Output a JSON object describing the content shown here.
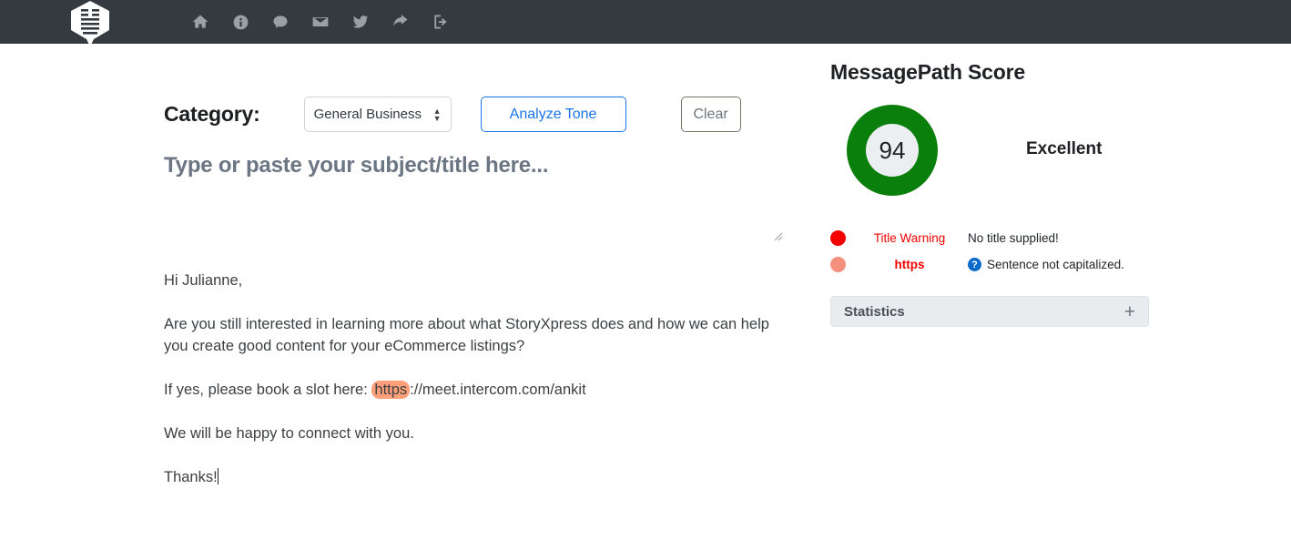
{
  "navbar": {
    "logo_name": "messagepath-logo",
    "background": "#343a40",
    "icons": [
      {
        "name": "home-icon",
        "label": "Home"
      },
      {
        "name": "info-circle-icon",
        "label": "About"
      },
      {
        "name": "comment-icon",
        "label": "Feedback"
      },
      {
        "name": "envelope-icon",
        "label": "Contact"
      },
      {
        "name": "twitter-icon",
        "label": "Twitter"
      },
      {
        "name": "share-icon",
        "label": "Share"
      },
      {
        "name": "sign-out-icon",
        "label": "Sign out"
      }
    ]
  },
  "toolbar": {
    "category_label": "Category:",
    "category_value": "General Business",
    "category_options": [
      "General Business"
    ],
    "analyze_label": "Analyze Tone",
    "clear_label": "Clear",
    "analyze_color": "#1a73e8"
  },
  "editor": {
    "title_placeholder": "Type or paste your subject/title here...",
    "title_value": "",
    "body_paragraphs": [
      {
        "text": "Hi Julianne,"
      },
      {
        "text": "Are you still interested in learning more about what StoryXpress does and how we can help you create good content for your eCommerce listings?"
      },
      {
        "pre": "If yes, please book a slot here: ",
        "highlight": "https",
        "post": "://meet.intercom.com/ankit"
      },
      {
        "text": "We will be happy to connect with you."
      },
      {
        "text": "Thanks!",
        "caret": true
      }
    ],
    "highlight_color": "#ffa07a"
  },
  "score_panel": {
    "title": "MessagePath Score",
    "score": "94",
    "rating": "Excellent",
    "ring_color": "#0b7f0b",
    "issues": [
      {
        "dot_color": "#f50000",
        "label": "Title Warning",
        "label_bold": false,
        "description": "No title supplied!",
        "has_help_icon": false
      },
      {
        "dot_color": "#f4907e",
        "label": "https",
        "label_bold": true,
        "description": "Sentence not capitalized.",
        "has_help_icon": true,
        "help_icon_glyph": "?"
      }
    ],
    "statistics": {
      "title": "Statistics",
      "toggle_glyph": "+"
    }
  }
}
